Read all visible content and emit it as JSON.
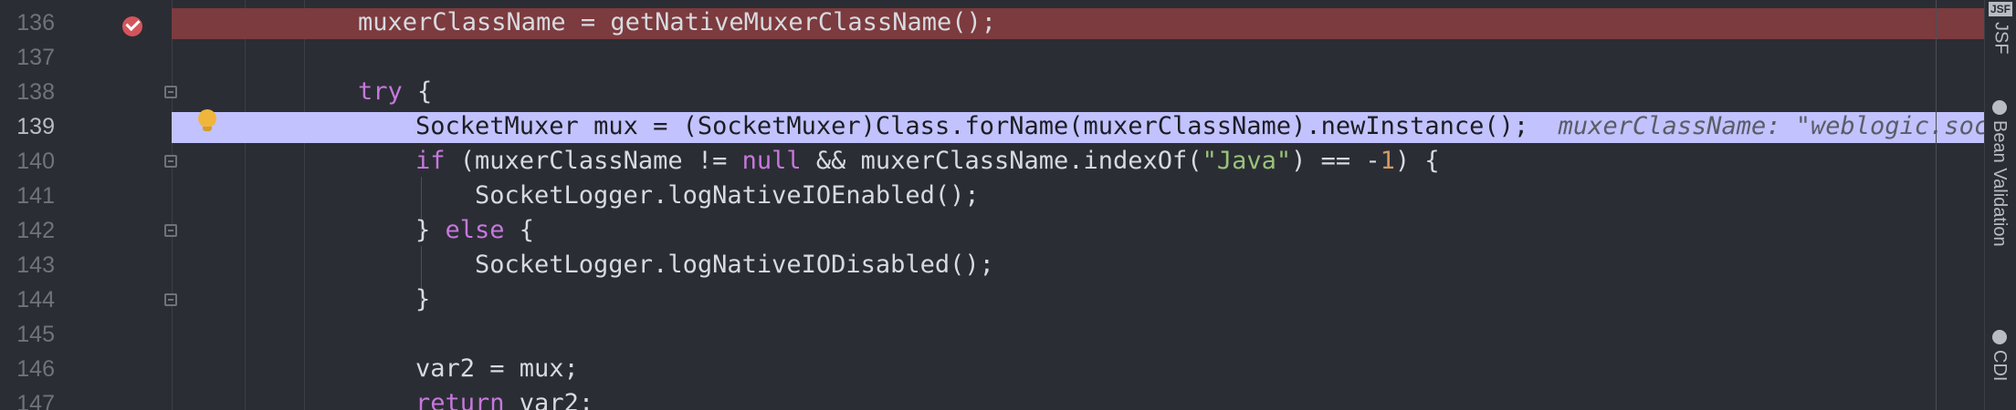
{
  "editor": {
    "lines": [
      {
        "num": "136",
        "state": "breakpoint",
        "code": "muxerClassName = getNativeMuxerClassName();"
      },
      {
        "num": "137",
        "state": "",
        "code": ""
      },
      {
        "num": "138",
        "state": "",
        "kw": "try",
        "rest": " {"
      },
      {
        "num": "139",
        "state": "execution",
        "code": "SocketMuxer mux = (SocketMuxer)Class.forName(muxerClassName).newInstance();",
        "inlay": "muxerClassName: \"weblogic.socke"
      },
      {
        "num": "140",
        "state": "",
        "kw1": "if",
        "p1": " (muxerClassName != ",
        "kw2": "null",
        "p2": " && muxerClassName.indexOf(",
        "str": "\"Java\"",
        "p3": ") == -",
        "num_lit": "1",
        "p4": ") {"
      },
      {
        "num": "141",
        "state": "",
        "code": "SocketLogger.logNativeIOEnabled();"
      },
      {
        "num": "142",
        "state": "",
        "p1": "} ",
        "kw": "else",
        "p2": " {"
      },
      {
        "num": "143",
        "state": "",
        "code": "SocketLogger.logNativeIODisabled();"
      },
      {
        "num": "144",
        "state": "",
        "code": "}"
      },
      {
        "num": "145",
        "state": "",
        "code": ""
      },
      {
        "num": "146",
        "state": "",
        "code": "var2 = mux;"
      },
      {
        "num": "147",
        "state": "",
        "kw": "return",
        "rest": " var2;"
      }
    ]
  },
  "tool_window_tabs": [
    {
      "label": "JSF",
      "icon": "jsf-icon"
    },
    {
      "label": "Bean Validation",
      "icon": "bean-validation-icon"
    },
    {
      "label": "CDI",
      "icon": "cdi-icon"
    }
  ],
  "colors": {
    "background": "#2b2d34",
    "breakpoint_line": "#7c3b3e",
    "execution_line": "#c2c2ff",
    "keyword": "#c678dd",
    "string": "#98c379",
    "number": "#d19a66"
  }
}
